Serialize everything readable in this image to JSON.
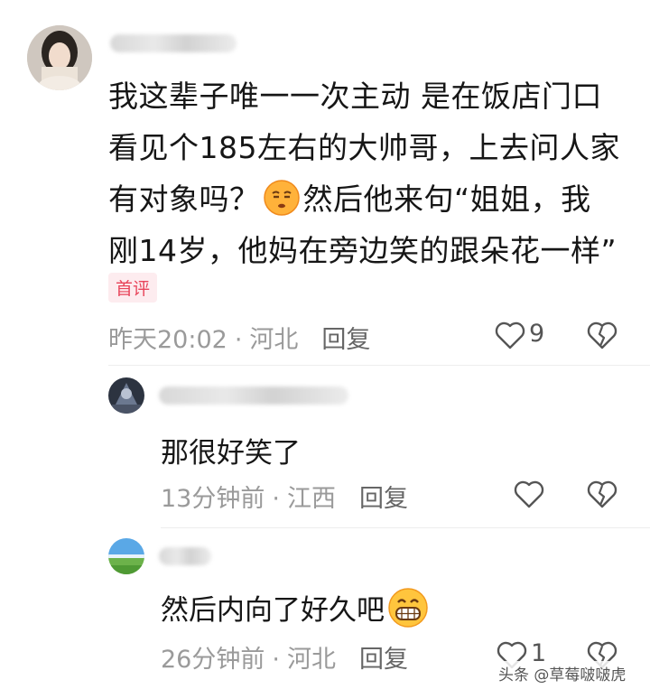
{
  "comment": {
    "text_line1": "我这辈子唯一一次主动 是在饭店门口",
    "text_line2": "看见个185左右的大帅哥，上去问人家",
    "text_line3a": "有对象吗？",
    "text_line3b": "然后他来句“姐姐，我",
    "text_line4": "刚14岁，他妈在旁边笑的跟朵花一样”",
    "badge": "首评",
    "time": "昨天20:02",
    "location": "河北",
    "reply_label": "回复",
    "like_count": "9"
  },
  "replies": [
    {
      "text": "那很好笑了",
      "time": "13分钟前",
      "location": "江西",
      "reply_label": "回复"
    },
    {
      "text": "然后内向了好久吧",
      "time": "26分钟前",
      "location": "河北",
      "reply_label": "回复",
      "like_count": "1"
    }
  ],
  "separator": "·",
  "watermark": "头条 @草莓啵啵虎"
}
